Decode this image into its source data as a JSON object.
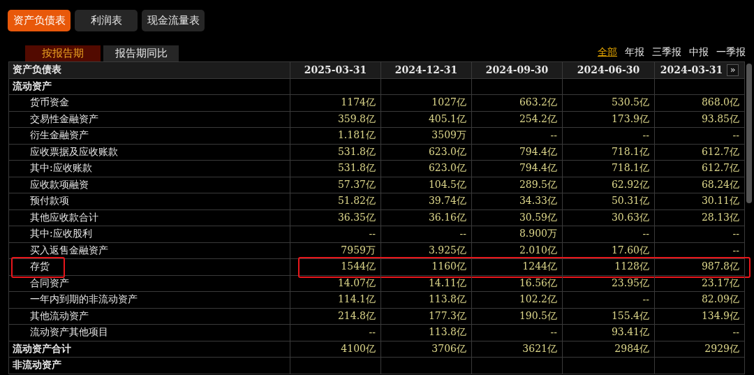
{
  "statement_tabs": [
    {
      "label": "资产负债表",
      "selected": true
    },
    {
      "label": "利润表",
      "selected": false
    },
    {
      "label": "现金流量表",
      "selected": false
    }
  ],
  "period_tabs": [
    {
      "label": "按报告期",
      "selected": true
    },
    {
      "label": "报告期同比",
      "selected": false
    }
  ],
  "period_filters": [
    {
      "label": "全部",
      "selected": true
    },
    {
      "label": "年报",
      "selected": false
    },
    {
      "label": "三季报",
      "selected": false
    },
    {
      "label": "中报",
      "selected": false
    },
    {
      "label": "一季报",
      "selected": false
    }
  ],
  "table": {
    "columns": [
      "资产负债表",
      "2025-03-31",
      "2024-12-31",
      "2024-09-30",
      "2024-06-30",
      "2024-03-31"
    ],
    "next_button": "»",
    "rows": [
      {
        "kind": "section",
        "label": "流动资产",
        "values": [],
        "highlighted": false
      },
      {
        "kind": "item",
        "label": "货币资金",
        "values": [
          "1174亿",
          "1027亿",
          "663.2亿",
          "530.5亿",
          "868.0亿"
        ],
        "highlighted": false
      },
      {
        "kind": "item",
        "label": "交易性金融资产",
        "values": [
          "359.8亿",
          "405.1亿",
          "254.2亿",
          "173.9亿",
          "93.85亿"
        ],
        "highlighted": false
      },
      {
        "kind": "item",
        "label": "衍生金融资产",
        "values": [
          "1.181亿",
          "3509万",
          "--",
          "--",
          "--"
        ],
        "highlighted": false
      },
      {
        "kind": "item",
        "label": "应收票据及应收账款",
        "values": [
          "531.8亿",
          "623.0亿",
          "794.4亿",
          "718.1亿",
          "612.7亿"
        ],
        "highlighted": false
      },
      {
        "kind": "item",
        "label": "其中:应收账款",
        "values": [
          "531.8亿",
          "623.0亿",
          "794.4亿",
          "718.1亿",
          "612.7亿"
        ],
        "highlighted": false
      },
      {
        "kind": "item",
        "label": "应收款项融资",
        "values": [
          "57.37亿",
          "104.5亿",
          "289.5亿",
          "62.92亿",
          "68.24亿"
        ],
        "highlighted": false
      },
      {
        "kind": "item",
        "label": "预付款项",
        "values": [
          "51.82亿",
          "39.74亿",
          "34.33亿",
          "50.31亿",
          "30.11亿"
        ],
        "highlighted": false
      },
      {
        "kind": "item",
        "label": "其他应收款合计",
        "values": [
          "36.35亿",
          "36.16亿",
          "30.59亿",
          "30.63亿",
          "28.13亿"
        ],
        "highlighted": false
      },
      {
        "kind": "item",
        "label": "其中:应收股利",
        "values": [
          "--",
          "--",
          "8.900万",
          "--",
          "--"
        ],
        "highlighted": false
      },
      {
        "kind": "item",
        "label": "买入返售金融资产",
        "values": [
          "7959万",
          "3.925亿",
          "2.010亿",
          "17.60亿",
          "--"
        ],
        "highlighted": false
      },
      {
        "kind": "item",
        "label": "存货",
        "values": [
          "1544亿",
          "1160亿",
          "1244亿",
          "1128亿",
          "987.8亿"
        ],
        "highlighted": true
      },
      {
        "kind": "item",
        "label": "合同资产",
        "values": [
          "14.07亿",
          "14.11亿",
          "16.56亿",
          "23.95亿",
          "23.17亿"
        ],
        "highlighted": false
      },
      {
        "kind": "item",
        "label": "一年内到期的非流动资产",
        "values": [
          "114.1亿",
          "113.8亿",
          "102.2亿",
          "--",
          "82.09亿"
        ],
        "highlighted": false
      },
      {
        "kind": "item",
        "label": "其他流动资产",
        "values": [
          "214.8亿",
          "177.3亿",
          "190.5亿",
          "155.4亿",
          "134.9亿"
        ],
        "highlighted": false
      },
      {
        "kind": "item",
        "label": "流动资产其他项目",
        "values": [
          "--",
          "113.8亿",
          "--",
          "93.41亿",
          "--"
        ],
        "highlighted": false
      },
      {
        "kind": "total",
        "label": "流动资产合计",
        "values": [
          "4100亿",
          "3706亿",
          "3621亿",
          "2984亿",
          "2929亿"
        ],
        "highlighted": false
      },
      {
        "kind": "section",
        "label": "非流动资产",
        "values": [],
        "highlighted": false
      }
    ]
  }
}
